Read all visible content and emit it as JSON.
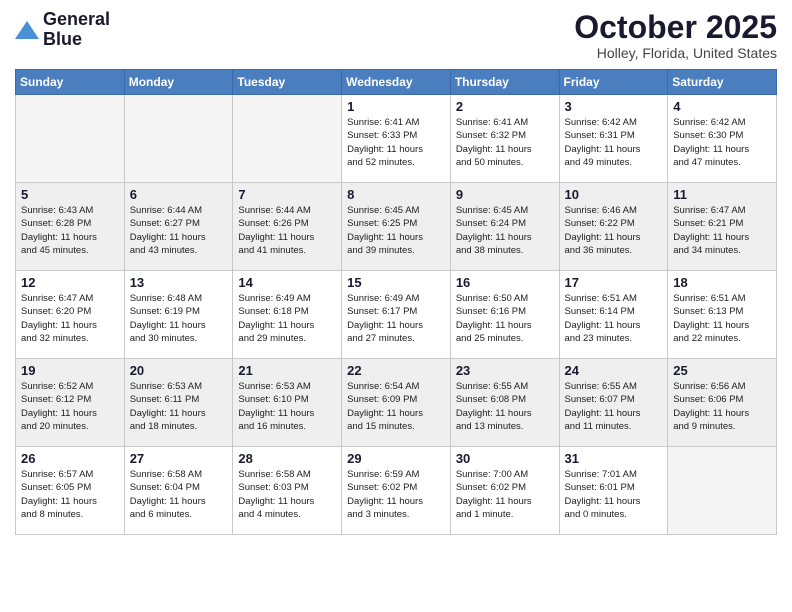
{
  "header": {
    "logo_general": "General",
    "logo_blue": "Blue",
    "month_title": "October 2025",
    "location": "Holley, Florida, United States"
  },
  "weekdays": [
    "Sunday",
    "Monday",
    "Tuesday",
    "Wednesday",
    "Thursday",
    "Friday",
    "Saturday"
  ],
  "weeks": [
    [
      {
        "day": "",
        "text": ""
      },
      {
        "day": "",
        "text": ""
      },
      {
        "day": "",
        "text": ""
      },
      {
        "day": "1",
        "text": "Sunrise: 6:41 AM\nSunset: 6:33 PM\nDaylight: 11 hours\nand 52 minutes."
      },
      {
        "day": "2",
        "text": "Sunrise: 6:41 AM\nSunset: 6:32 PM\nDaylight: 11 hours\nand 50 minutes."
      },
      {
        "day": "3",
        "text": "Sunrise: 6:42 AM\nSunset: 6:31 PM\nDaylight: 11 hours\nand 49 minutes."
      },
      {
        "day": "4",
        "text": "Sunrise: 6:42 AM\nSunset: 6:30 PM\nDaylight: 11 hours\nand 47 minutes."
      }
    ],
    [
      {
        "day": "5",
        "text": "Sunrise: 6:43 AM\nSunset: 6:28 PM\nDaylight: 11 hours\nand 45 minutes."
      },
      {
        "day": "6",
        "text": "Sunrise: 6:44 AM\nSunset: 6:27 PM\nDaylight: 11 hours\nand 43 minutes."
      },
      {
        "day": "7",
        "text": "Sunrise: 6:44 AM\nSunset: 6:26 PM\nDaylight: 11 hours\nand 41 minutes."
      },
      {
        "day": "8",
        "text": "Sunrise: 6:45 AM\nSunset: 6:25 PM\nDaylight: 11 hours\nand 39 minutes."
      },
      {
        "day": "9",
        "text": "Sunrise: 6:45 AM\nSunset: 6:24 PM\nDaylight: 11 hours\nand 38 minutes."
      },
      {
        "day": "10",
        "text": "Sunrise: 6:46 AM\nSunset: 6:22 PM\nDaylight: 11 hours\nand 36 minutes."
      },
      {
        "day": "11",
        "text": "Sunrise: 6:47 AM\nSunset: 6:21 PM\nDaylight: 11 hours\nand 34 minutes."
      }
    ],
    [
      {
        "day": "12",
        "text": "Sunrise: 6:47 AM\nSunset: 6:20 PM\nDaylight: 11 hours\nand 32 minutes."
      },
      {
        "day": "13",
        "text": "Sunrise: 6:48 AM\nSunset: 6:19 PM\nDaylight: 11 hours\nand 30 minutes."
      },
      {
        "day": "14",
        "text": "Sunrise: 6:49 AM\nSunset: 6:18 PM\nDaylight: 11 hours\nand 29 minutes."
      },
      {
        "day": "15",
        "text": "Sunrise: 6:49 AM\nSunset: 6:17 PM\nDaylight: 11 hours\nand 27 minutes."
      },
      {
        "day": "16",
        "text": "Sunrise: 6:50 AM\nSunset: 6:16 PM\nDaylight: 11 hours\nand 25 minutes."
      },
      {
        "day": "17",
        "text": "Sunrise: 6:51 AM\nSunset: 6:14 PM\nDaylight: 11 hours\nand 23 minutes."
      },
      {
        "day": "18",
        "text": "Sunrise: 6:51 AM\nSunset: 6:13 PM\nDaylight: 11 hours\nand 22 minutes."
      }
    ],
    [
      {
        "day": "19",
        "text": "Sunrise: 6:52 AM\nSunset: 6:12 PM\nDaylight: 11 hours\nand 20 minutes."
      },
      {
        "day": "20",
        "text": "Sunrise: 6:53 AM\nSunset: 6:11 PM\nDaylight: 11 hours\nand 18 minutes."
      },
      {
        "day": "21",
        "text": "Sunrise: 6:53 AM\nSunset: 6:10 PM\nDaylight: 11 hours\nand 16 minutes."
      },
      {
        "day": "22",
        "text": "Sunrise: 6:54 AM\nSunset: 6:09 PM\nDaylight: 11 hours\nand 15 minutes."
      },
      {
        "day": "23",
        "text": "Sunrise: 6:55 AM\nSunset: 6:08 PM\nDaylight: 11 hours\nand 13 minutes."
      },
      {
        "day": "24",
        "text": "Sunrise: 6:55 AM\nSunset: 6:07 PM\nDaylight: 11 hours\nand 11 minutes."
      },
      {
        "day": "25",
        "text": "Sunrise: 6:56 AM\nSunset: 6:06 PM\nDaylight: 11 hours\nand 9 minutes."
      }
    ],
    [
      {
        "day": "26",
        "text": "Sunrise: 6:57 AM\nSunset: 6:05 PM\nDaylight: 11 hours\nand 8 minutes."
      },
      {
        "day": "27",
        "text": "Sunrise: 6:58 AM\nSunset: 6:04 PM\nDaylight: 11 hours\nand 6 minutes."
      },
      {
        "day": "28",
        "text": "Sunrise: 6:58 AM\nSunset: 6:03 PM\nDaylight: 11 hours\nand 4 minutes."
      },
      {
        "day": "29",
        "text": "Sunrise: 6:59 AM\nSunset: 6:02 PM\nDaylight: 11 hours\nand 3 minutes."
      },
      {
        "day": "30",
        "text": "Sunrise: 7:00 AM\nSunset: 6:02 PM\nDaylight: 11 hours\nand 1 minute."
      },
      {
        "day": "31",
        "text": "Sunrise: 7:01 AM\nSunset: 6:01 PM\nDaylight: 11 hours\nand 0 minutes."
      },
      {
        "day": "",
        "text": ""
      }
    ]
  ]
}
